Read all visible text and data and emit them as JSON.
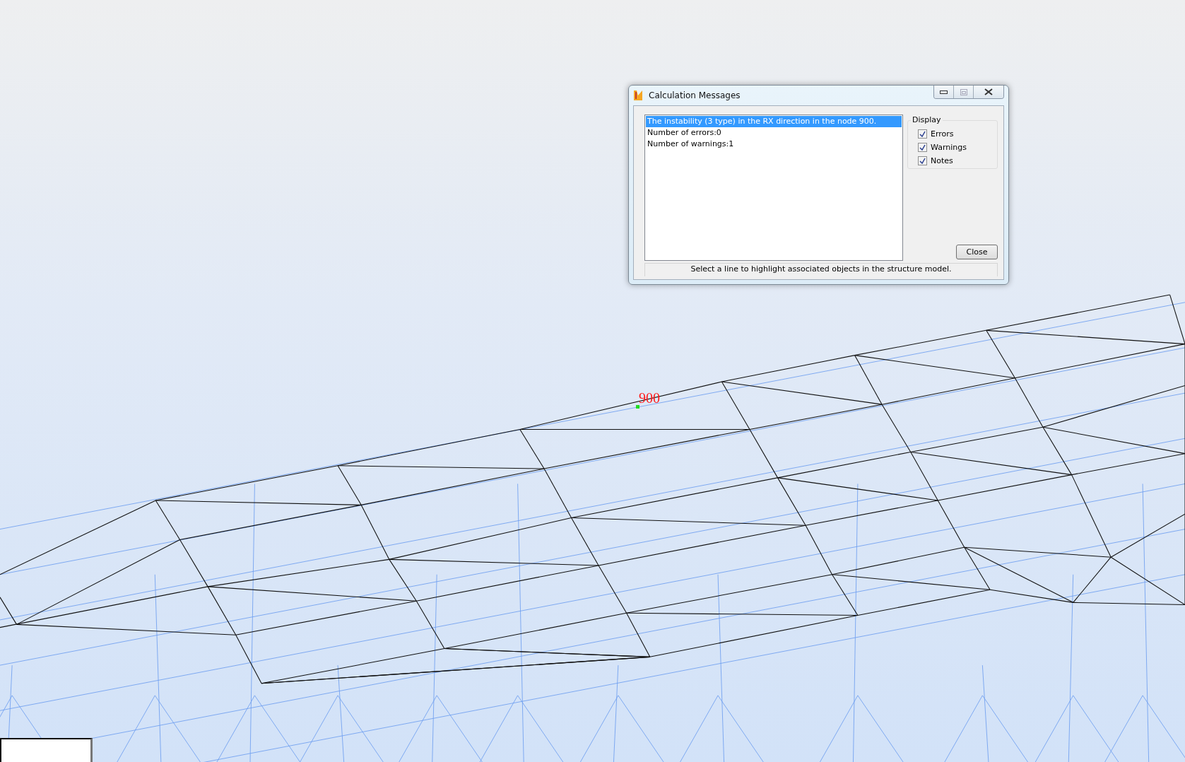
{
  "viewport": {
    "node_label": "900"
  },
  "dialog": {
    "title": "Calculation Messages",
    "messages": [
      {
        "text": "The instability (3 type) in the RX direction in the node 900.",
        "selected": true
      },
      {
        "text": "Number of errors:0",
        "selected": false
      },
      {
        "text": "Number of warnings:1",
        "selected": false
      }
    ],
    "display": {
      "label": "Display",
      "options": [
        {
          "label": "Errors",
          "checked": true
        },
        {
          "label": "Warnings",
          "checked": true
        },
        {
          "label": "Notes",
          "checked": true
        }
      ]
    },
    "close_button": "Close",
    "status": "Select a line to highlight associated objects in the structure model."
  }
}
